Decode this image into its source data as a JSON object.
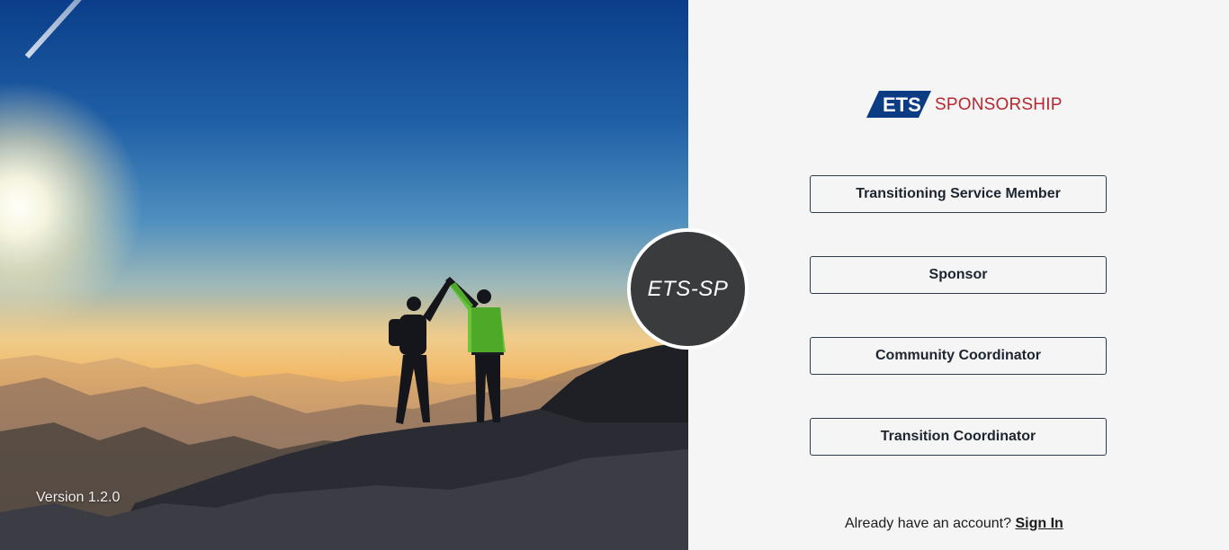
{
  "hero": {
    "version_label": "Version 1.2.0",
    "image_icon": "hikers-high-five-silhouette-photo"
  },
  "badge": {
    "label": "ETS-SP"
  },
  "logo": {
    "mark_text": "ETS",
    "brand_text": "SPONSORSHIP",
    "mark_color": "#0c3c83",
    "brand_color": "#b8272f"
  },
  "roles": [
    {
      "label": "Transitioning Service Member"
    },
    {
      "label": "Sponsor"
    },
    {
      "label": "Community Coordinator"
    },
    {
      "label": "Transition Coordinator"
    }
  ],
  "signin": {
    "prompt": "Already have an account?",
    "link_label": "Sign In"
  }
}
